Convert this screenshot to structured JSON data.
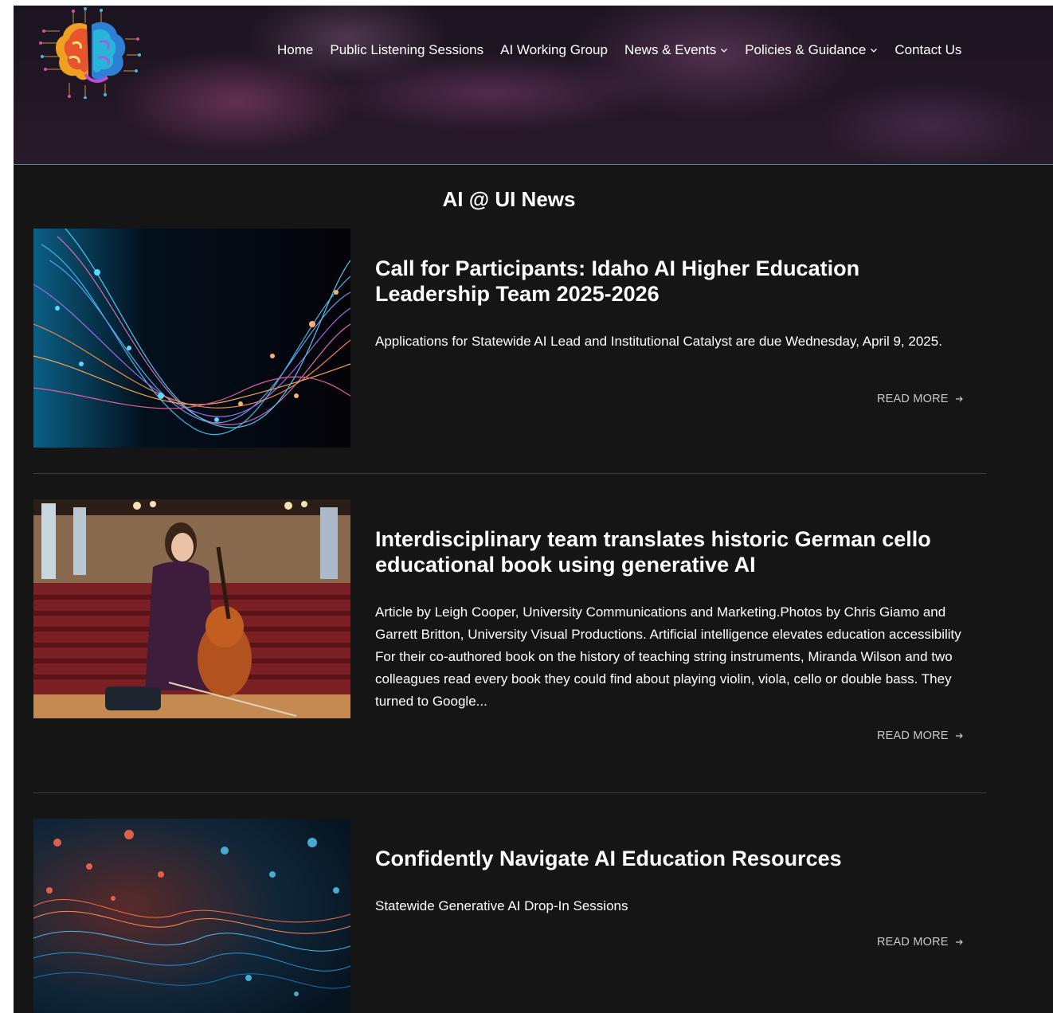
{
  "nav": {
    "items": [
      {
        "label": "Home"
      },
      {
        "label": "Public Listening Sessions"
      },
      {
        "label": "AI Working Group"
      },
      {
        "label": "News & Events"
      },
      {
        "label": "Policies & Guidance"
      },
      {
        "label": "Contact Us"
      }
    ]
  },
  "section_title": "AI @ UI News",
  "articles": [
    {
      "title": "Call for Participants: Idaho AI Higher Education Leadership Team 2025-2026",
      "excerpt": "Applications for Statewide AI Lead and Institutional Catalyst are due Wednesday, April 9, 2025.",
      "read_more": "READ MORE",
      "image": "abstract-light-waves-image"
    },
    {
      "title": "Interdisciplinary team translates historic German cello educational book using generative AI",
      "excerpt": "Article by Leigh Cooper, University Communications and Marketing.Photos by Chris Giamo and Garrett Britton, University Visual Productions. Artificial intelligence elevates education accessibility For their co-authored book on the history of teaching string instruments, Miranda Wilson and two colleagues read every book they could find about playing violin, viola, cello or double bass. They turned to Google...",
      "read_more": "READ MORE",
      "image": "cellist-in-auditorium-photo"
    },
    {
      "title": "Confidently Navigate AI Education Resources",
      "excerpt": "Statewide Generative AI Drop-In Sessions",
      "read_more": "READ MORE",
      "image": "particle-wave-image"
    }
  ],
  "colors": {
    "background": "#151515",
    "header_border": "#3a8fa6",
    "read_more": "#c9c9c9"
  }
}
